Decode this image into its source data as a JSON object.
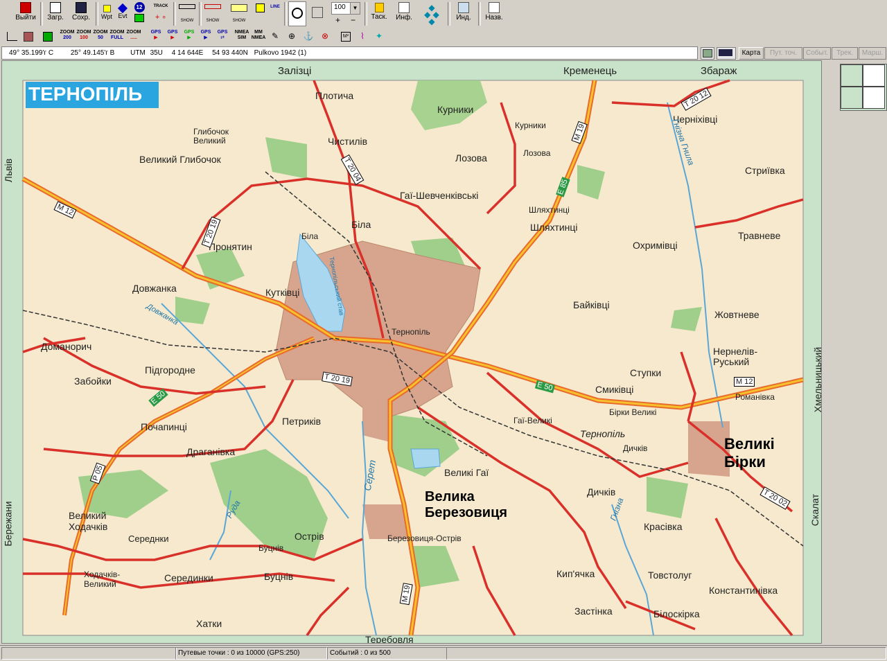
{
  "toolbar": {
    "exit": "Выйти",
    "load": "Загр.",
    "save": "Сохр.",
    "wpt": "Wpt",
    "evt": "Evt",
    "twelve": "12",
    "track": "TRACK",
    "show1": "SHOW",
    "show2": "SHOW",
    "show3": "SHOW",
    "line": "LINE",
    "zoom_value": "100",
    "tasks": "Таск.",
    "info": "Инф.",
    "ind": "Инд.",
    "names": "Назв."
  },
  "toolbar2": {
    "zooms": [
      {
        "top": "ZOOM",
        "bottom": "200"
      },
      {
        "top": "ZOOM",
        "bottom": "100"
      },
      {
        "top": "ZOOM",
        "bottom": "50"
      },
      {
        "top": "ZOOM",
        "bottom": "FULL"
      },
      {
        "top": "ZOOM",
        "bottom": "....."
      }
    ],
    "gps": [
      "GPS",
      "GPS",
      "GPS",
      "GPS",
      "GPS"
    ],
    "nmea_sim": "NMEA SIM",
    "nmea_mm": "MM NMEA"
  },
  "coordbar": {
    "lat": "49° 35.199'г С",
    "lon": "25° 49.145'г В",
    "utm_label": "UTM",
    "zone": "35U",
    "easting": "4 14 644E",
    "northing": "54 93 440N",
    "datum": "Pulkovo 1942 (1)"
  },
  "tabs": {
    "map": "Карта",
    "waypoints": "Пут. точ.",
    "events": "Событ.",
    "track": "Трек.",
    "route": "Марш."
  },
  "map": {
    "title": "ТЕРНОПІЛЬ",
    "edge_labels": {
      "north_left": "Залізці",
      "north_mid": "Кременець",
      "north_right": "Збараж",
      "west_top": "Львів",
      "west_bottom": "Бережани",
      "east_top": "Хмельницький",
      "east_bottom": "Скалат",
      "south": "Теребовля"
    },
    "places": [
      {
        "name": "Плотича"
      },
      {
        "name": "Курники"
      },
      {
        "name": "Курники"
      },
      {
        "name": "Глибочок Великий"
      },
      {
        "name": "Чистилів"
      },
      {
        "name": "Лозова"
      },
      {
        "name": "Лозова"
      },
      {
        "name": "Великий Глибочок"
      },
      {
        "name": "Гаї-Шевченківські"
      },
      {
        "name": "Біла"
      },
      {
        "name": "Біла"
      },
      {
        "name": "Шляхтинці"
      },
      {
        "name": "Шляхтинці"
      },
      {
        "name": "Пронятин"
      },
      {
        "name": "Охримівці"
      },
      {
        "name": "Травневе"
      },
      {
        "name": "Стриївка"
      },
      {
        "name": "Черніхівці"
      },
      {
        "name": "Довжанка"
      },
      {
        "name": "Кутківці"
      },
      {
        "name": "Тернопільський став"
      },
      {
        "name": "Байківці"
      },
      {
        "name": "Жовтневе"
      },
      {
        "name": "Тернопіль"
      },
      {
        "name": "Доманорич"
      },
      {
        "name": "Нернелів-Руський"
      },
      {
        "name": "Ступки"
      },
      {
        "name": "Смиківці"
      },
      {
        "name": "Романівка"
      },
      {
        "name": "Забойки"
      },
      {
        "name": "Підгородне"
      },
      {
        "name": "Бірки Великі"
      },
      {
        "name": "Гаї-Великі"
      },
      {
        "name": "Тернопіль"
      },
      {
        "name": "Почапинці"
      },
      {
        "name": "Петриків"
      },
      {
        "name": "Великі Бірки"
      },
      {
        "name": "Дичків"
      },
      {
        "name": "Драганівка"
      },
      {
        "name": "Великі Гаї"
      },
      {
        "name": "Серет"
      },
      {
        "name": "Дичків"
      },
      {
        "name": "Велика Березовиця"
      },
      {
        "name": "Великий Ходачків"
      },
      {
        "name": "Гнізна"
      },
      {
        "name": "Красівка"
      },
      {
        "name": "Середнки"
      },
      {
        "name": "Острів"
      },
      {
        "name": "Буцнів"
      },
      {
        "name": "Березовиця-Острів"
      },
      {
        "name": "Руда"
      },
      {
        "name": "Ходачків-Великий"
      },
      {
        "name": "Серединки"
      },
      {
        "name": "Буцнів"
      },
      {
        "name": "Кип'ячка"
      },
      {
        "name": "Товстолуг"
      },
      {
        "name": "Константинівка"
      },
      {
        "name": "Застінка"
      },
      {
        "name": "Білоскірка"
      },
      {
        "name": "Хатки"
      },
      {
        "name": "Гнізна Гнила"
      },
      {
        "name": "Довжанка"
      }
    ],
    "road_labels": [
      "M 12",
      "T 20 19",
      "T 20 04",
      "M 19",
      "E 85",
      "T 20 12",
      "E 50",
      "E 50",
      "T 20 19",
      "M 12",
      "P 05",
      "M 19",
      "T 20 02"
    ]
  },
  "status": {
    "waypoints": "Путевые точки : 0 из 10000  (GPS:250)",
    "events": "Событий : 0 из 500"
  }
}
